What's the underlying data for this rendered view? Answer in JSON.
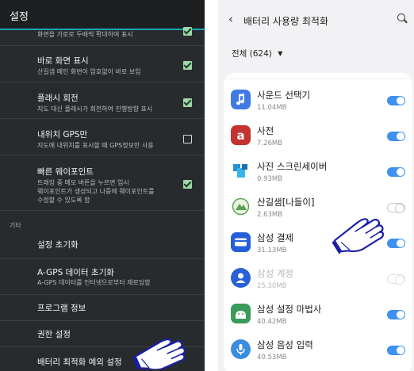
{
  "left_panel": {
    "title": "설정",
    "rows": [
      {
        "sub": "화면을 가로로 두배씩 확대하여 표시",
        "checked": true
      },
      {
        "title": "바로 화면 표시",
        "sub": "산길샘 메인 화면이 암호없이 바로 보임",
        "checked": true
      },
      {
        "title": "플래시 회전",
        "sub": "지도 대신 플래시가 회전하여 진행방향 표시",
        "checked": true
      },
      {
        "title": "내위치 GPS만",
        "sub": "지도에 내위치를 표시할 때 GPS정보만 사용",
        "checked": false
      },
      {
        "title": "빠른 웨이포인트",
        "sub_lines": [
          "트래킹 중 메모 버튼을 누르면 임시",
          "웨이포인트가 생성되고 나중에 웨이포인트를",
          "수정할 수 있도록 함"
        ],
        "checked": true
      }
    ],
    "section": "기타",
    "items": [
      {
        "title": "설정 초기화"
      },
      {
        "title": "A-GPS 데이터 초기화",
        "sub": "A-GPS 데이터를 인터넷으로부터 재로딩함"
      },
      {
        "title": "프로그램 정보"
      },
      {
        "title": "권한 설정"
      },
      {
        "title": "배터리 최적화 예외 설정"
      }
    ]
  },
  "right_panel": {
    "title": "배터리 사용량 최적화",
    "filter": "전체 (624)",
    "apps": [
      {
        "name": "사운드 선택기",
        "size": "11.04MB",
        "icon": "sound-picker-icon",
        "color": "#3f7be3",
        "on": true
      },
      {
        "name": "사전",
        "size": "7.26MB",
        "icon": "dictionary-icon",
        "color": "#c4332f",
        "on": true
      },
      {
        "name": "사진 스크린세이버",
        "size": "0.93MB",
        "icon": "photo-screensaver-icon",
        "color": "#2a8fd0",
        "on": true
      },
      {
        "name": "산길샘[나들이]",
        "size": "2.63MB",
        "icon": "sangilsaem-icon",
        "color": "#5aa052",
        "on": false
      },
      {
        "name": "삼성 결제",
        "size": "31.13MB",
        "icon": "samsung-pay-icon",
        "color": "#2560d8",
        "on": true
      },
      {
        "name": "삼성 계정",
        "size": "25.30MB",
        "icon": "samsung-account-icon",
        "color": "#2b5fd6",
        "on": false,
        "dim": true
      },
      {
        "name": "삼성 설정 마법사",
        "size": "40.42MB",
        "icon": "setup-wizard-icon",
        "color": "#3a9b5a",
        "on": true
      },
      {
        "name": "삼성 음성 입력",
        "size": "40.53MB",
        "icon": "voice-input-icon",
        "color": "#3a8de0",
        "on": true
      }
    ]
  }
}
